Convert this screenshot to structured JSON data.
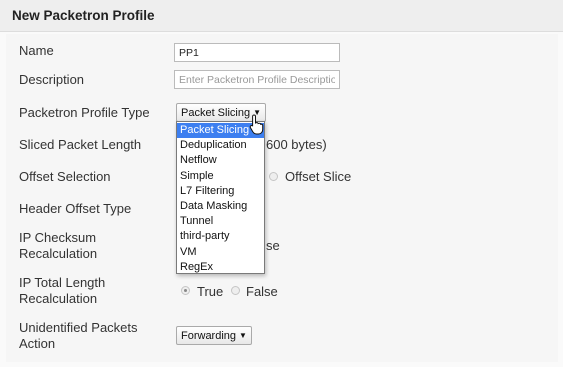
{
  "header": {
    "title": "New Packetron Profile"
  },
  "fields": {
    "name": {
      "label": "Name",
      "value": "PP1"
    },
    "description": {
      "label": "Description",
      "placeholder": "Enter Packetron Profile Description"
    },
    "profile_type": {
      "label": "Packetron Profile Type",
      "selected": "Packet Slicing",
      "options": [
        "Packet Slicing",
        "Deduplication",
        "Netflow",
        "Simple",
        "L7 Filtering",
        "Data Masking",
        "Tunnel",
        "third-party",
        "VM",
        "RegEx"
      ]
    },
    "sliced_packet_length": {
      "label": "Sliced Packet Length",
      "visible_text": "600 bytes)"
    },
    "offset_selection": {
      "label": "Offset Selection",
      "option_offset_slice": "Offset Slice"
    },
    "header_offset_type": {
      "label": "Header Offset Type"
    },
    "ip_checksum": {
      "label_line1": "IP Checksum",
      "label_line2": "Recalculation",
      "visible_text": "se"
    },
    "ip_total_length": {
      "label_line1": "IP Total Length",
      "label_line2": "Recalculation",
      "option_true": "True",
      "option_false": "False",
      "selected": "True"
    },
    "unidentified_packets": {
      "label_line1": "Unidentified Packets",
      "label_line2": "Action",
      "selected": "Forwarding"
    }
  },
  "colors": {
    "highlight": "#3d7ff0",
    "header_bg": "#eeeeee"
  },
  "icons": {
    "cursor": "pointer-cursor-icon",
    "caret": "caret-down-icon"
  }
}
